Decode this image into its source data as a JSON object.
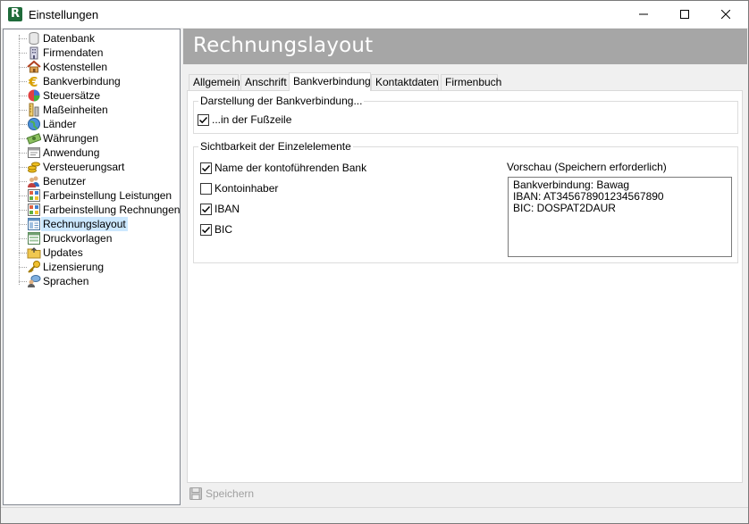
{
  "window": {
    "title": "Einstellungen"
  },
  "sidebar": {
    "items": [
      {
        "label": "Datenbank",
        "icon": "database-icon"
      },
      {
        "label": "Firmendaten",
        "icon": "building-icon"
      },
      {
        "label": "Kostenstellen",
        "icon": "house-icon"
      },
      {
        "label": "Bankverbindung",
        "icon": "euro-icon"
      },
      {
        "label": "Steuersätze",
        "icon": "pie-chart-icon"
      },
      {
        "label": "Maßeinheiten",
        "icon": "ruler-icon"
      },
      {
        "label": "Länder",
        "icon": "globe-icon"
      },
      {
        "label": "Währungen",
        "icon": "money-icon"
      },
      {
        "label": "Anwendung",
        "icon": "window-icon"
      },
      {
        "label": "Versteuerungsart",
        "icon": "coins-icon"
      },
      {
        "label": "Benutzer",
        "icon": "users-icon"
      },
      {
        "label": "Farbeinstellung Leistungen",
        "icon": "palette-grid-icon"
      },
      {
        "label": "Farbeinstellung Rechnungen",
        "icon": "palette-grid-icon"
      },
      {
        "label": "Rechnungslayout",
        "icon": "layout-icon"
      },
      {
        "label": "Druckvorlagen",
        "icon": "template-icon"
      },
      {
        "label": "Updates",
        "icon": "folder-icon"
      },
      {
        "label": "Lizensierung",
        "icon": "key-icon"
      },
      {
        "label": "Sprachen",
        "icon": "speech-icon"
      }
    ],
    "selected_index": 13
  },
  "header": {
    "title": "Rechnungslayout"
  },
  "tabs": [
    {
      "label": "Allgemein"
    },
    {
      "label": "Anschrift"
    },
    {
      "label": "Bankverbindung"
    },
    {
      "label": "Kontaktdaten"
    },
    {
      "label": "Firmenbuch"
    }
  ],
  "active_tab_index": 2,
  "display_group": {
    "title": "Darstellung der Bankverbindung...",
    "footer_checkbox": {
      "label": "...in der Fußzeile",
      "checked": true
    }
  },
  "visibility_group": {
    "title": "Sichtbarkeit der Einzelelemente",
    "checkboxes": [
      {
        "label": "Name der kontoführenden Bank",
        "checked": true
      },
      {
        "label": "Kontoinhaber",
        "checked": false
      },
      {
        "label": "IBAN",
        "checked": true
      },
      {
        "label": "BIC",
        "checked": true
      }
    ],
    "preview_label": "Vorschau (Speichern erforderlich)",
    "preview_lines": [
      "Bankverbindung: Bawag",
      "IBAN: AT345678901234567890",
      "BIC: DOSPAT2DAUR"
    ]
  },
  "footer": {
    "save_label": "Speichern"
  },
  "colors": {
    "header_bg": "#a6a6a6",
    "selection_bg": "#cce8ff",
    "disabled_text": "#a0a0a0"
  }
}
